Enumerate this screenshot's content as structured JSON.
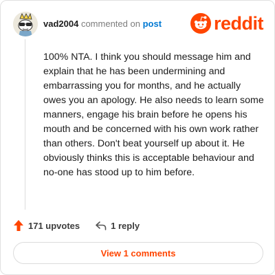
{
  "header": {
    "username": "vad2004",
    "action_text": "commented on",
    "post_link": "post",
    "logo_text": "reddit",
    "logo_icon": "reddit-alien-icon",
    "avatar_icon": "snoo-avatar"
  },
  "comment": {
    "body": "100% NTA. I think you should message him and explain that he has been undermining and embarrassing you for months, and he actually owes you an apology. He also needs to learn some manners, engage his brain before he opens his mouth and be concerned with his own work rather than others. Don't beat yourself up about it. He obviously thinks this is acceptable behaviour and no-one has stood up to him before."
  },
  "actions": {
    "upvotes_label": "171 upvotes",
    "upvote_icon": "upvote-arrow-icon",
    "replies_label": "1 reply",
    "reply_icon": "reply-arrow-icon"
  },
  "footer": {
    "view_comments_label": "View 1 comments"
  },
  "colors": {
    "brand": "#ff4500",
    "link": "#0079d3",
    "text": "#1c1c1c",
    "muted": "#7c7c7c"
  }
}
